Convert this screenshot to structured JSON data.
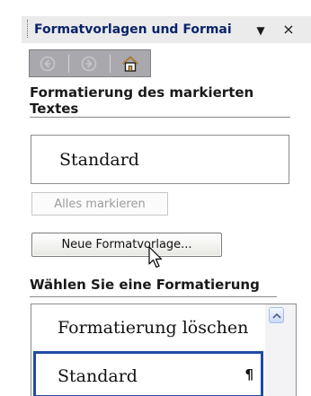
{
  "pane": {
    "title": "Formatvorlagen und Formatierung",
    "title_truncated": "Formatvorlagen und Formai",
    "dropdown_glyph": "▼",
    "close_glyph": "×"
  },
  "nav": {
    "back_icon": "back-arrow-icon",
    "forward_icon": "forward-arrow-icon",
    "home_icon": "home-icon"
  },
  "section1": {
    "heading": "Formatierung des markierten Textes"
  },
  "current_style": {
    "value": "Standard"
  },
  "buttons": {
    "select_all": "Alles markieren",
    "new_style": "Neue Formatvorlage..."
  },
  "section2": {
    "heading": "Wählen Sie eine Formatierung"
  },
  "style_list": {
    "items": [
      {
        "label": "Formatierung löschen",
        "mark": ""
      },
      {
        "label": "Standard",
        "mark": "¶"
      }
    ]
  },
  "colors": {
    "title_text": "#0a246a",
    "selected_border": "#1f4ba5",
    "nav_bg": "#a9a9ad"
  }
}
